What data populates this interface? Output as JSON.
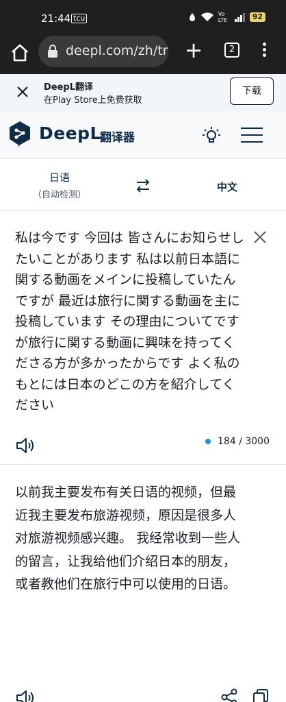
{
  "status_bar": {
    "time": "21:44",
    "small_indicator": "tcu",
    "signal_label": "Vo LTE",
    "battery": "92"
  },
  "browser": {
    "url": "deepl.com/zh/tra",
    "tab_count": "2"
  },
  "app_banner": {
    "title": "DeepL翻译",
    "subtitle": "在Play Store上免费获取",
    "download_label": "下载"
  },
  "header": {
    "brand": "DeepL",
    "product": "翻译器"
  },
  "languages": {
    "source": "日语",
    "source_detect": "（自动检测）",
    "target": "中文"
  },
  "source": {
    "text": "私は今です 今回は 皆さんにお知らせしたいことがあります 私は以前日本語に関する動画をメインに投稿していたんですが 最近は旅行に関する動画を主に投稿しています その理由についてですが旅行に関する動画に興味を持ってくださる方が多かったからです よく私のもとには日本のどこの方を紹介してください",
    "char_count": "184 / 3000"
  },
  "target": {
    "text": "以前我主要发布有关日语的视频，但最近我主要发布旅游视频，原因是很多人对旅游视频感兴趣。 我经常收到一些人的留言，让我给他们介绍日本的朋友，或者教他们在旅行中可以使用的日语。"
  },
  "colors": {
    "browser_chrome": "#1f1f1f",
    "deepl_navy": "#0f2b46",
    "banner_bg": "#f2f6fb",
    "count_dot": "#1f8fc8"
  }
}
